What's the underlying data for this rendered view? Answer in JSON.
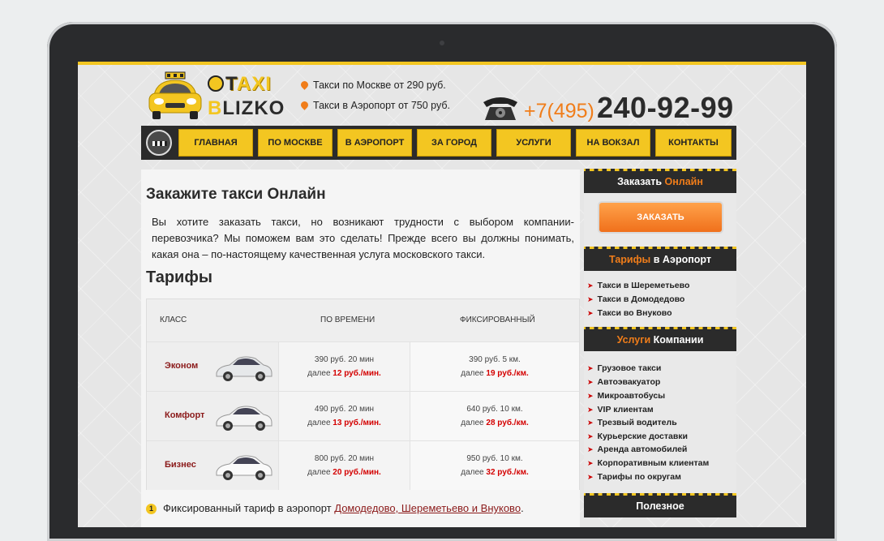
{
  "header": {
    "logo_top": "AXI",
    "logo_bottom": "LIZKO",
    "promo_1": "Такси по Москве от 290 руб.",
    "promo_2": "Такси в Аэропорт от 750 руб.",
    "phone_code": "+7(495)",
    "phone_number": "240-92-99"
  },
  "nav": {
    "items": [
      "Главная",
      "По Москве",
      "В аэропорт",
      "За город",
      "Услуги",
      "На вокзал",
      "Контакты"
    ]
  },
  "main": {
    "title": "Закажите такси Онлайн",
    "intro": "Вы хотите заказать такси, но возникают трудности с выбором компании-перевозчика? Мы поможем вам это сделать! Прежде всего вы должны понимать, какая она – по-настоящему качественная услуга московского такси.",
    "tariffs_title": "Тарифы",
    "table": {
      "headers": [
        "Класс",
        "По времени",
        "Фиксированный"
      ],
      "rows": [
        {
          "class": "Эконом",
          "time_1": "390 руб. 20 мин",
          "time_2_prefix": "далее",
          "time_2_value": "12 руб./мин.",
          "fixed_1": "390 руб. 5 км.",
          "fixed_2_prefix": "далее",
          "fixed_2_value": "19 руб./км."
        },
        {
          "class": "Комфорт",
          "time_1": "490 руб. 20 мин",
          "time_2_prefix": "далее",
          "time_2_value": "13 руб./мин.",
          "fixed_1": "640 руб. 10 км.",
          "fixed_2_prefix": "далее",
          "fixed_2_value": "28 руб./км."
        },
        {
          "class": "Бизнес",
          "time_1": "800 руб. 20 мин",
          "time_2_prefix": "далее",
          "time_2_value": "20 руб./мин.",
          "fixed_1": "950 руб. 10 км.",
          "fixed_2_prefix": "далее",
          "fixed_2_value": "32 руб./км."
        }
      ]
    },
    "note_num": "1",
    "note_text": "Фиксированный тариф в аэропорт",
    "note_link": "Домодедово, Шереметьево и Внуково",
    "note_end": "."
  },
  "sidebar": {
    "order_head_1": "Заказать",
    "order_head_2": "Онлайн",
    "order_button": "Заказать",
    "airport_head_1": "Тарифы",
    "airport_head_2": "в Аэропорт",
    "airport_items": [
      "Такси в Шереметьево",
      "Такси в Домодедово",
      "Такси во Внуково"
    ],
    "services_head_1": "Услуги",
    "services_head_2": "Компании",
    "services_items": [
      "Грузовое такси",
      "Автоэвакуатор",
      "Микроавтобусы",
      "VIP клиентам",
      "Трезвый водитель",
      "Курьерские доставки",
      "Аренда автомобилей",
      "Корпоративным клиентам",
      "Тарифы по округам"
    ],
    "useful_head": "Полезное"
  }
}
